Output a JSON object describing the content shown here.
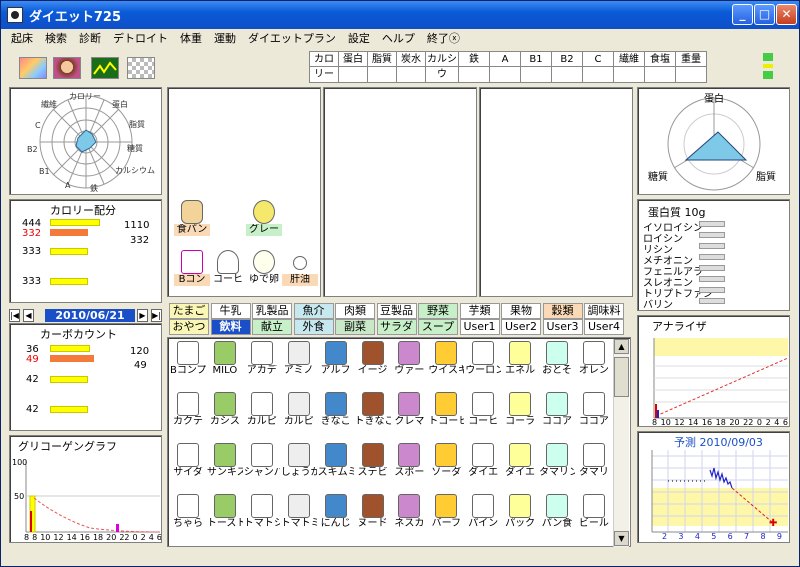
{
  "window": {
    "title": "ダイエット725"
  },
  "menu": [
    "起床",
    "検索",
    "診断",
    "デトロイト",
    "体重",
    "運動",
    "ダイエットプラン",
    "設定",
    "ヘルプ",
    "終了ⓧ"
  ],
  "nutrients": [
    "カロリー",
    "蛋白",
    "脂質",
    "炭水",
    "カルシウ",
    "鉄",
    "A",
    "B1",
    "B2",
    "C",
    "繊維",
    "食塩",
    "重量"
  ],
  "radar_labels": [
    "カロリー",
    "蛋白",
    "脂質",
    "糖質",
    "カルシウム",
    "鉄",
    "A",
    "B1",
    "B2",
    "C",
    "繊維"
  ],
  "calorie_panel": {
    "title": "カロリー配分",
    "v1": "444",
    "v2": "332",
    "v3": "333",
    "v4": "333",
    "r1": "1110",
    "r2": "332"
  },
  "date": "2010/06/21",
  "carb_panel": {
    "title": "カーボカウント",
    "v1": "36",
    "v2": "49",
    "v3": "42",
    "v4": "42",
    "r1": "120",
    "r2": "49"
  },
  "glycogen": {
    "title": "グリコーゲングラフ",
    "y_ticks": [
      "100",
      "50"
    ],
    "x_ticks": [
      "8",
      "8",
      "10",
      "12",
      "14",
      "16",
      "18",
      "20",
      "22",
      "0",
      "2",
      "4",
      "6"
    ]
  },
  "meal_items": [
    {
      "label": "食パン",
      "color": "#f9d9b6"
    },
    {
      "label": "グレー",
      "color": "#c8f0c8"
    },
    {
      "label": "Bコン",
      "color": "#f9d9b6"
    },
    {
      "label": "コーヒ",
      "color": "#fff"
    },
    {
      "label": "ゆで卵",
      "color": "#fff"
    },
    {
      "label": "肝油",
      "color": "#f9d9b6"
    }
  ],
  "triangle": {
    "labels": [
      "蛋白",
      "糖質",
      "脂質"
    ]
  },
  "amino": {
    "title": "蛋白質 10g",
    "items": [
      "イソロイシン",
      "ロイシン",
      "リシン",
      "メチオニン",
      "フェニルアラ",
      "スレオニン",
      "トリプトファン",
      "バリン"
    ],
    "values": [
      0.2,
      0.2,
      0.2,
      0.2,
      0.2,
      0.2,
      0.2,
      0.2
    ]
  },
  "categories_row1": [
    "たまご",
    "牛乳",
    "乳製品",
    "魚介",
    "肉類",
    "豆製品",
    "野菜",
    "芋類",
    "果物",
    "穀類",
    "調味料"
  ],
  "categories_row2": [
    "おやつ",
    "飲料",
    "献立",
    "外食",
    "副菜",
    "サラダ",
    "スープ",
    "User1",
    "User2",
    "User3",
    "User4"
  ],
  "foods": [
    "Bコンプ",
    "MILO",
    "アカデ",
    "アミノ",
    "アルフ",
    "イージ",
    "ヴァー",
    "ウイスキ",
    "ウーロン",
    "エネル",
    "おとそ",
    "オレン",
    "カクテ",
    "カシス",
    "カルピ",
    "カルピ",
    "きなこ",
    "トきなこ",
    "クレマ",
    "トコーヒ",
    "コーヒ",
    "コーラ",
    "ココア",
    "ココア",
    "サイダ",
    "サンキス",
    "シャンパ",
    "しょうが",
    "スキムミ",
    "ステビ",
    "スポー",
    "ソーダ",
    "ダイエ",
    "ダイエ",
    "タマリン",
    "タマリ",
    "ちゃら",
    "トースト",
    "トマトシ",
    "トマトミ",
    "にんじ",
    "ヌード",
    "ネスカ",
    "バーフ",
    "パイン",
    "パック",
    "パン食",
    "ビール"
  ],
  "analyzer": {
    "title": "アナライザ",
    "x_ticks": [
      "8",
      "10",
      "12",
      "14",
      "16",
      "18",
      "20",
      "22",
      "0",
      "2",
      "4",
      "6"
    ]
  },
  "forecast": {
    "title": "予測 2010/09/03",
    "x_ticks": [
      "2",
      "3",
      "4",
      "5",
      "6",
      "7",
      "8",
      "9"
    ]
  }
}
